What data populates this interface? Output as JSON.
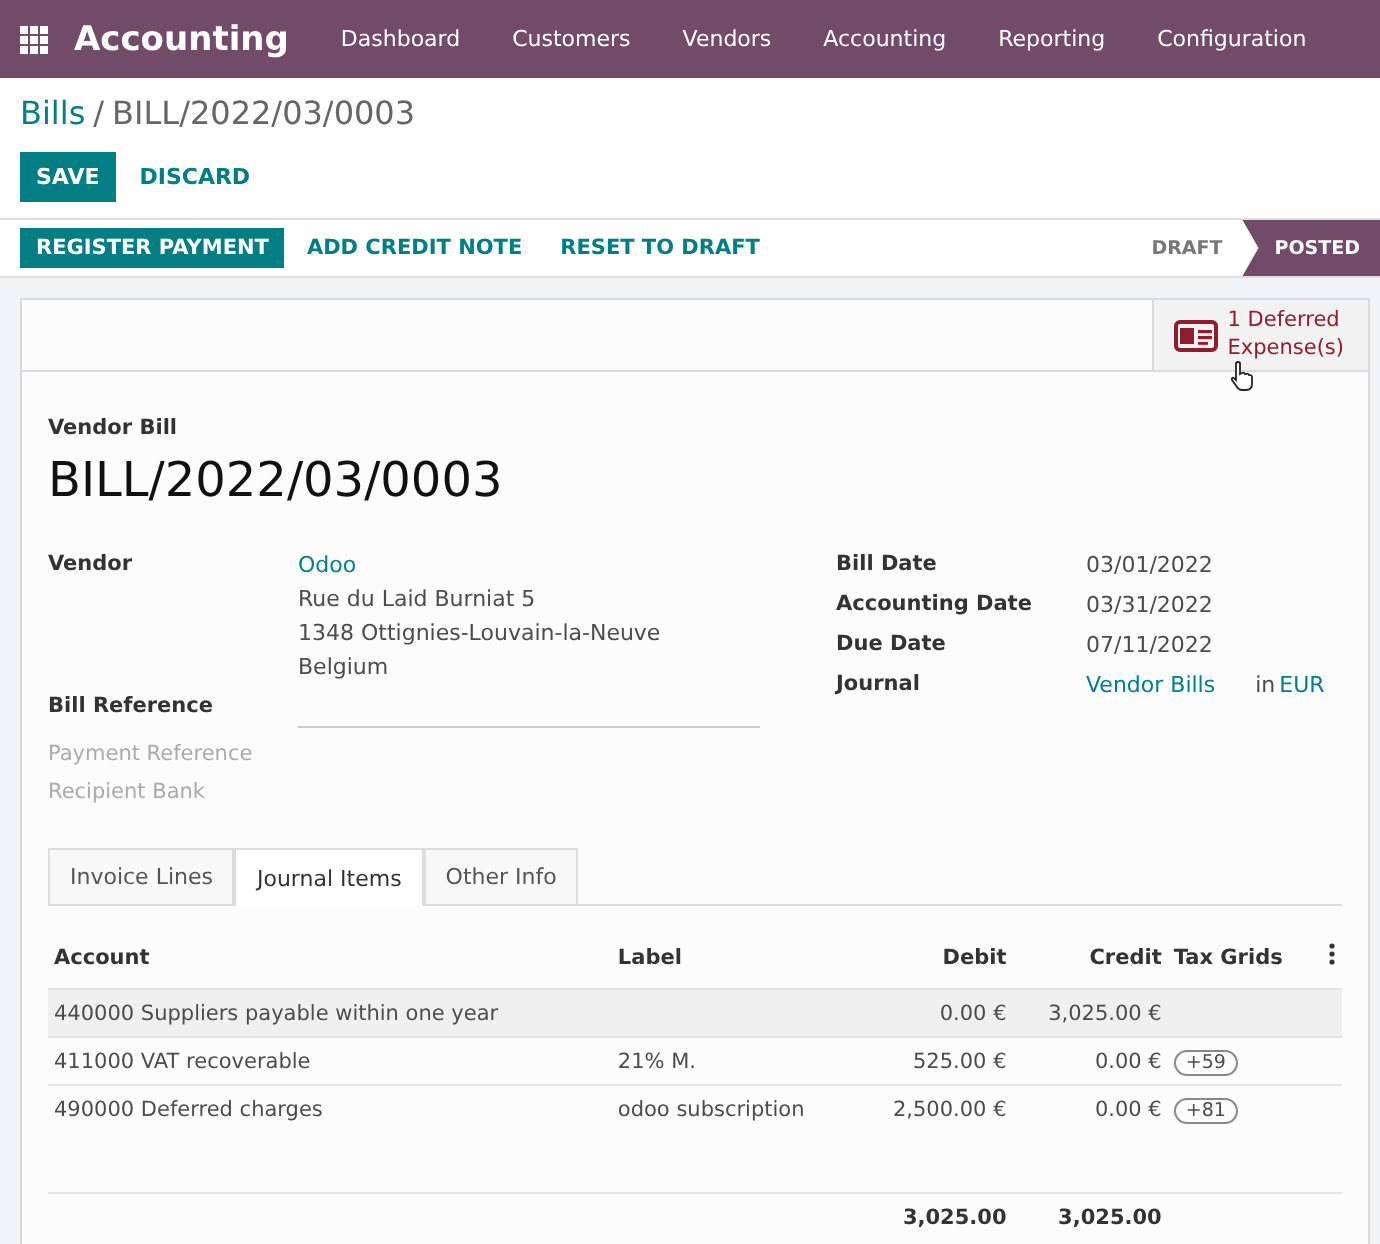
{
  "navbar": {
    "app_name": "Accounting",
    "menu": [
      "Dashboard",
      "Customers",
      "Vendors",
      "Accounting",
      "Reporting",
      "Configuration"
    ]
  },
  "breadcrumb": {
    "parent": "Bills",
    "separator": "/",
    "current": "BILL/2022/03/0003"
  },
  "form_buttons": [
    {
      "label": "SAVE",
      "kind": "primary"
    },
    {
      "label": "DISCARD",
      "kind": "link"
    }
  ],
  "actions": [
    {
      "label": "REGISTER PAYMENT",
      "kind": "primary"
    },
    {
      "label": "ADD CREDIT NOTE",
      "kind": "link"
    },
    {
      "label": "RESET TO DRAFT",
      "kind": "link"
    }
  ],
  "stages": [
    {
      "label": "DRAFT",
      "selected": false
    },
    {
      "label": "POSTED",
      "selected": true
    }
  ],
  "smart_button": {
    "count": "1",
    "label": "Deferred",
    "label_2": "Expense(s)"
  },
  "document_type": "Vendor Bill",
  "document_name": "BILL/2022/03/0003",
  "left_fields": [
    {
      "label": "Vendor",
      "kind": "address",
      "link": "Odoo",
      "lines": [
        "Rue du Laid Burniat 5",
        "1348 Ottignies-Louvain-la-Neuve",
        "Belgium"
      ]
    },
    {
      "label": "Bill Reference",
      "kind": "input"
    },
    {
      "label": "Payment Reference",
      "kind": "muted"
    },
    {
      "label": "Recipient Bank",
      "kind": "muted"
    }
  ],
  "right_fields": [
    {
      "label": "Bill Date",
      "value": "03/01/2022",
      "kind": "text"
    },
    {
      "label": "Accounting Date",
      "value": "03/31/2022",
      "kind": "text"
    },
    {
      "label": "Due Date",
      "value": "07/11/2022",
      "kind": "text"
    },
    {
      "label": "Journal",
      "value": "Vendor Bills",
      "kind": "journal",
      "joiner": "in",
      "currency": "EUR"
    }
  ],
  "tabs": [
    {
      "label": "Invoice Lines",
      "selected": false
    },
    {
      "label": "Journal Items",
      "selected": true
    },
    {
      "label": "Other Info",
      "selected": false
    }
  ],
  "table": {
    "columns": [
      "Account",
      "Label",
      "Debit",
      "Credit",
      "Tax Grids"
    ],
    "rows": [
      {
        "account": "440000 Suppliers payable within one year",
        "label": "",
        "debit": "0.00 €",
        "credit": "3,025.00 €",
        "tax_grid": "",
        "selected": true
      },
      {
        "account": "411000 VAT recoverable",
        "label": "21% M.",
        "debit": "525.00 €",
        "credit": "0.00 €",
        "tax_grid": "+59",
        "selected": false
      },
      {
        "account": "490000 Deferred charges",
        "label": "odoo subscription",
        "debit": "2,500.00 €",
        "credit": "0.00 €",
        "tax_grid": "+81",
        "selected": false
      }
    ],
    "totals": {
      "debit": "3,025.00",
      "credit": "3,025.00"
    }
  }
}
